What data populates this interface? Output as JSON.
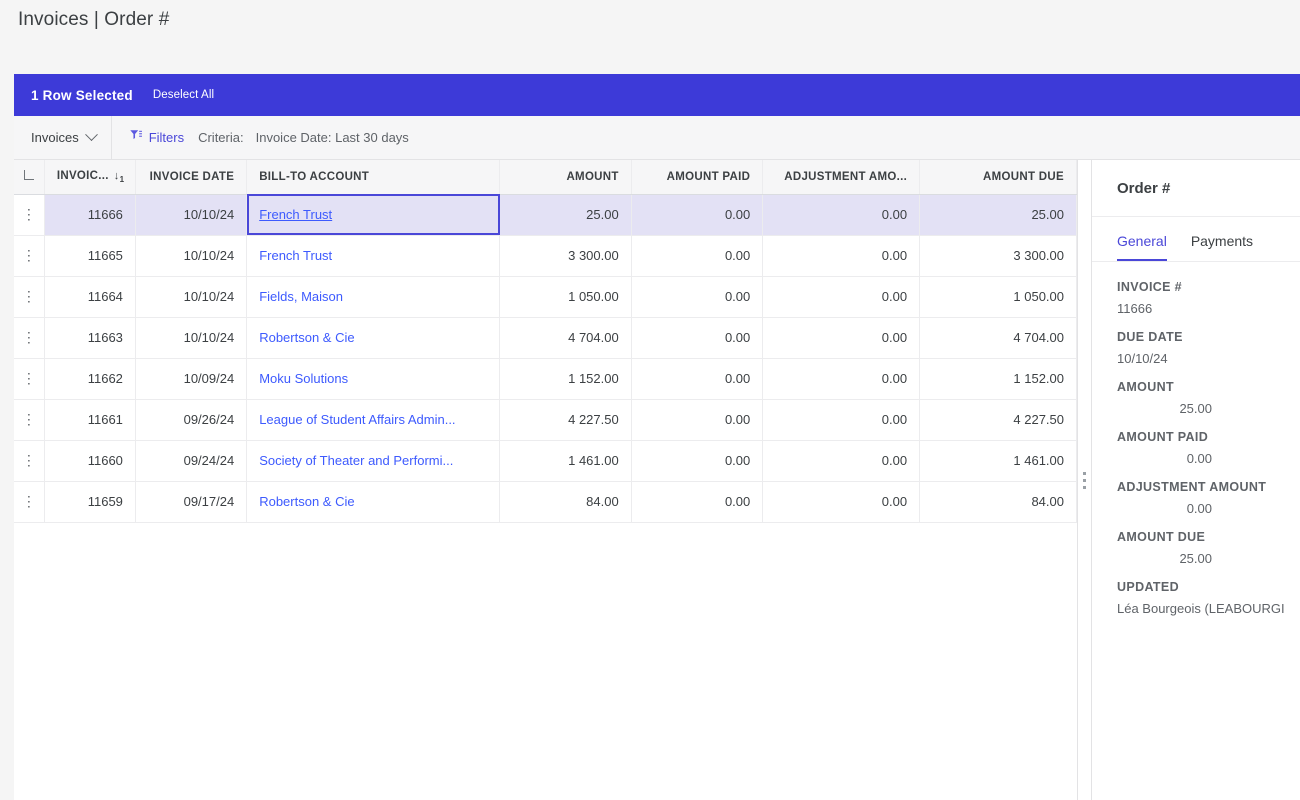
{
  "page": {
    "title": "Invoices | Order #"
  },
  "banner": {
    "count_label": "1 Row Selected",
    "deselect_label": "Deselect All"
  },
  "toolbar": {
    "view_label": "Invoices",
    "filters_label": "Filters",
    "criteria_label": "Criteria:",
    "criteria_value": "Invoice Date: Last 30 days"
  },
  "grid": {
    "columns": [
      {
        "key": "invoice",
        "label": "INVOIC...",
        "align": "num",
        "sort": "↓",
        "sort_order": "1"
      },
      {
        "key": "date",
        "label": "INVOICE DATE",
        "align": "num",
        "sort": "",
        "sort_order": ""
      },
      {
        "key": "account",
        "label": "BILL-TO ACCOUNT",
        "align": "txt",
        "sort": "",
        "sort_order": ""
      },
      {
        "key": "amount",
        "label": "AMOUNT",
        "align": "num",
        "sort": "",
        "sort_order": ""
      },
      {
        "key": "paid",
        "label": "AMOUNT PAID",
        "align": "num",
        "sort": "",
        "sort_order": ""
      },
      {
        "key": "adjust",
        "label": "ADJUSTMENT AMO...",
        "align": "num",
        "sort": "",
        "sort_order": ""
      },
      {
        "key": "due",
        "label": "AMOUNT DUE",
        "align": "num",
        "sort": "",
        "sort_order": ""
      }
    ],
    "row_menu_icon": "kebab-menu-icon",
    "rows": [
      {
        "invoice": "11666",
        "date": "10/10/24",
        "account": "French Trust",
        "amount": "25.00",
        "paid": "0.00",
        "adjust": "0.00",
        "due": "25.00",
        "selected": true,
        "focused": true
      },
      {
        "invoice": "11665",
        "date": "10/10/24",
        "account": "French Trust",
        "amount": "3 300.00",
        "paid": "0.00",
        "adjust": "0.00",
        "due": "3 300.00",
        "selected": false,
        "focused": false
      },
      {
        "invoice": "11664",
        "date": "10/10/24",
        "account": "Fields, Maison",
        "amount": "1 050.00",
        "paid": "0.00",
        "adjust": "0.00",
        "due": "1 050.00",
        "selected": false,
        "focused": false
      },
      {
        "invoice": "11663",
        "date": "10/10/24",
        "account": "Robertson & Cie",
        "amount": "4 704.00",
        "paid": "0.00",
        "adjust": "0.00",
        "due": "4 704.00",
        "selected": false,
        "focused": false
      },
      {
        "invoice": "11662",
        "date": "10/09/24",
        "account": "Moku Solutions",
        "amount": "1 152.00",
        "paid": "0.00",
        "adjust": "0.00",
        "due": "1 152.00",
        "selected": false,
        "focused": false
      },
      {
        "invoice": "11661",
        "date": "09/26/24",
        "account": "League of Student Affairs Admin...",
        "amount": "4 227.50",
        "paid": "0.00",
        "adjust": "0.00",
        "due": "4 227.50",
        "selected": false,
        "focused": false
      },
      {
        "invoice": "11660",
        "date": "09/24/24",
        "account": "Society of Theater and Performi...",
        "amount": "1 461.00",
        "paid": "0.00",
        "adjust": "0.00",
        "due": "1 461.00",
        "selected": false,
        "focused": false
      },
      {
        "invoice": "11659",
        "date": "09/17/24",
        "account": "Robertson & Cie",
        "amount": "84.00",
        "paid": "0.00",
        "adjust": "0.00",
        "due": "84.00",
        "selected": false,
        "focused": false
      }
    ]
  },
  "detail": {
    "title": "Order #",
    "tabs": [
      {
        "label": "General",
        "active": true
      },
      {
        "label": "Payments",
        "active": false
      }
    ],
    "fields": [
      {
        "label": "INVOICE #",
        "value": "11666",
        "align": "txt"
      },
      {
        "label": "DUE DATE",
        "value": "10/10/24",
        "align": "txt"
      },
      {
        "label": "AMOUNT",
        "value": "25.00",
        "align": "num"
      },
      {
        "label": "AMOUNT PAID",
        "value": "0.00",
        "align": "num"
      },
      {
        "label": "ADJUSTMENT AMOUNT",
        "value": "0.00",
        "align": "num"
      },
      {
        "label": "AMOUNT DUE",
        "value": "25.00",
        "align": "num"
      },
      {
        "label": "UPDATED",
        "value": "Léa Bourgeois (LEABOURGI",
        "align": "txt"
      }
    ]
  },
  "colors": {
    "accent": "#3d3ad8",
    "link": "#3d5afe",
    "selected_row": "#e3e1f5",
    "toolbar_bg": "#f6f6f7",
    "page_bg": "#f5f5f5"
  }
}
